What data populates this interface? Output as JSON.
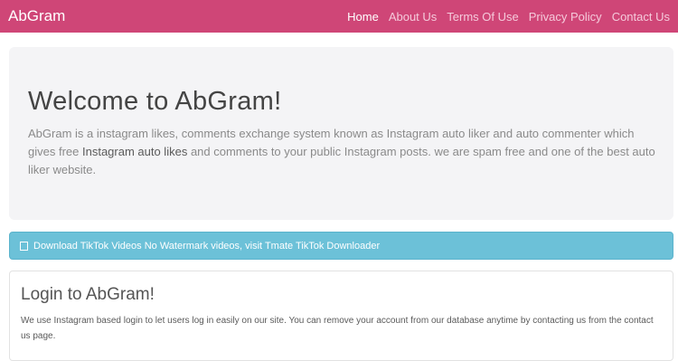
{
  "navbar": {
    "brand": "AbGram",
    "links": [
      {
        "label": "Home",
        "active": true
      },
      {
        "label": "About Us",
        "active": false
      },
      {
        "label": "Terms Of Use",
        "active": false
      },
      {
        "label": "Privacy Policy",
        "active": false
      },
      {
        "label": "Contact Us",
        "active": false
      }
    ]
  },
  "hero": {
    "title": "Welcome to AbGram!",
    "text_before": "AbGram is a instagram likes, comments exchange system known as Instagram auto liker and auto commenter which gives free ",
    "text_strong": "Instagram auto likes",
    "text_after": " and comments to your public Instagram posts. we are spam free and one of the best auto liker website."
  },
  "alert": {
    "icon": "external-link-icon",
    "text": "Download TikTok Videos No Watermark videos, visit Tmate TikTok Downloader"
  },
  "login_card": {
    "title": "Login to AbGram!",
    "text": "We use Instagram based login to let users log in easily on our site. You can remove your account from our database anytime by contacting us from the contact us page."
  },
  "colors": {
    "navbar": "#cf4677",
    "alert": "#6cc1d8",
    "jumbotron": "#f4f4f6"
  }
}
